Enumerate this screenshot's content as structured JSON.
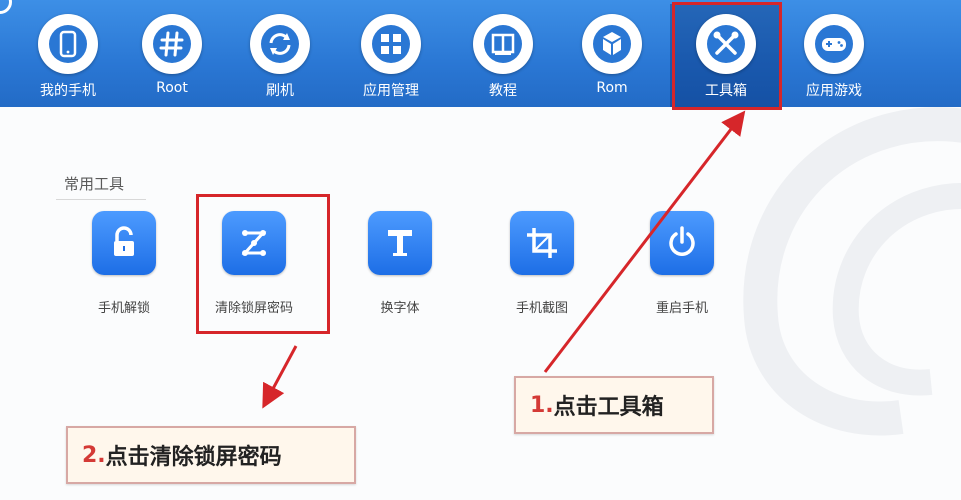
{
  "nav": {
    "items": [
      {
        "label": "我的手机",
        "icon": "phone-icon"
      },
      {
        "label": "Root",
        "icon": "hash-icon"
      },
      {
        "label": "刷机",
        "icon": "refresh-icon"
      },
      {
        "label": "应用管理",
        "icon": "grid-icon"
      },
      {
        "label": "教程",
        "icon": "book-icon"
      },
      {
        "label": "Rom",
        "icon": "box-icon"
      },
      {
        "label": "工具箱",
        "icon": "wrench-screwdriver-icon"
      },
      {
        "label": "应用游戏",
        "icon": "gamepad-icon"
      }
    ],
    "active_index": 6
  },
  "section": {
    "title": "常用工具"
  },
  "tools": [
    {
      "label": "手机解锁",
      "icon": "unlock-icon"
    },
    {
      "label": "清除锁屏密码",
      "icon": "pattern-lock-icon"
    },
    {
      "label": "换字体",
      "icon": "font-icon"
    },
    {
      "label": "手机截图",
      "icon": "crop-icon"
    },
    {
      "label": "重启手机",
      "icon": "power-icon"
    }
  ],
  "callouts": {
    "step1": {
      "num": "1.",
      "text": "点击工具箱"
    },
    "step2": {
      "num": "2.",
      "text": "点击清除锁屏密码"
    }
  },
  "colors": {
    "topbar": "#2a77d4",
    "tile": "#1d6ee6",
    "highlight": "#d6262a"
  }
}
